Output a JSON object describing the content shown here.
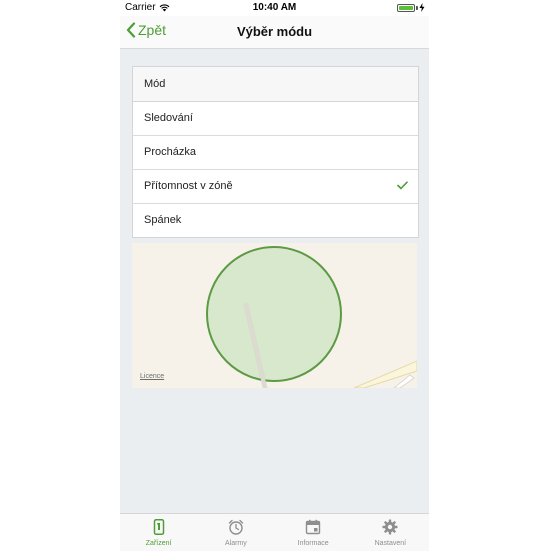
{
  "status_bar": {
    "carrier": "Carrier",
    "time": "10:40 AM",
    "battery_color": "#5bbf3a"
  },
  "nav": {
    "back_label": "Zpět",
    "title": "Výběr módu",
    "accent_color": "#4c9d36"
  },
  "mode_list": {
    "header": "Mód",
    "items": [
      {
        "label": "Sledování",
        "selected": false
      },
      {
        "label": "Procházka",
        "selected": false
      },
      {
        "label": "Přítomnost v zóně",
        "selected": true
      },
      {
        "label": "Spánek",
        "selected": false
      }
    ]
  },
  "map": {
    "licence_label": "Licence",
    "zone_fill": "#d8e8cc",
    "zone_stroke": "#5d9a44"
  },
  "tab_bar": {
    "tabs": [
      {
        "label": "Zařízení",
        "icon": "device-icon",
        "active": true
      },
      {
        "label": "Alarmy",
        "icon": "alarm-clock-icon",
        "active": false
      },
      {
        "label": "Informace",
        "icon": "calendar-icon",
        "active": false
      },
      {
        "label": "Nastavení",
        "icon": "gear-icon",
        "active": false
      }
    ]
  }
}
